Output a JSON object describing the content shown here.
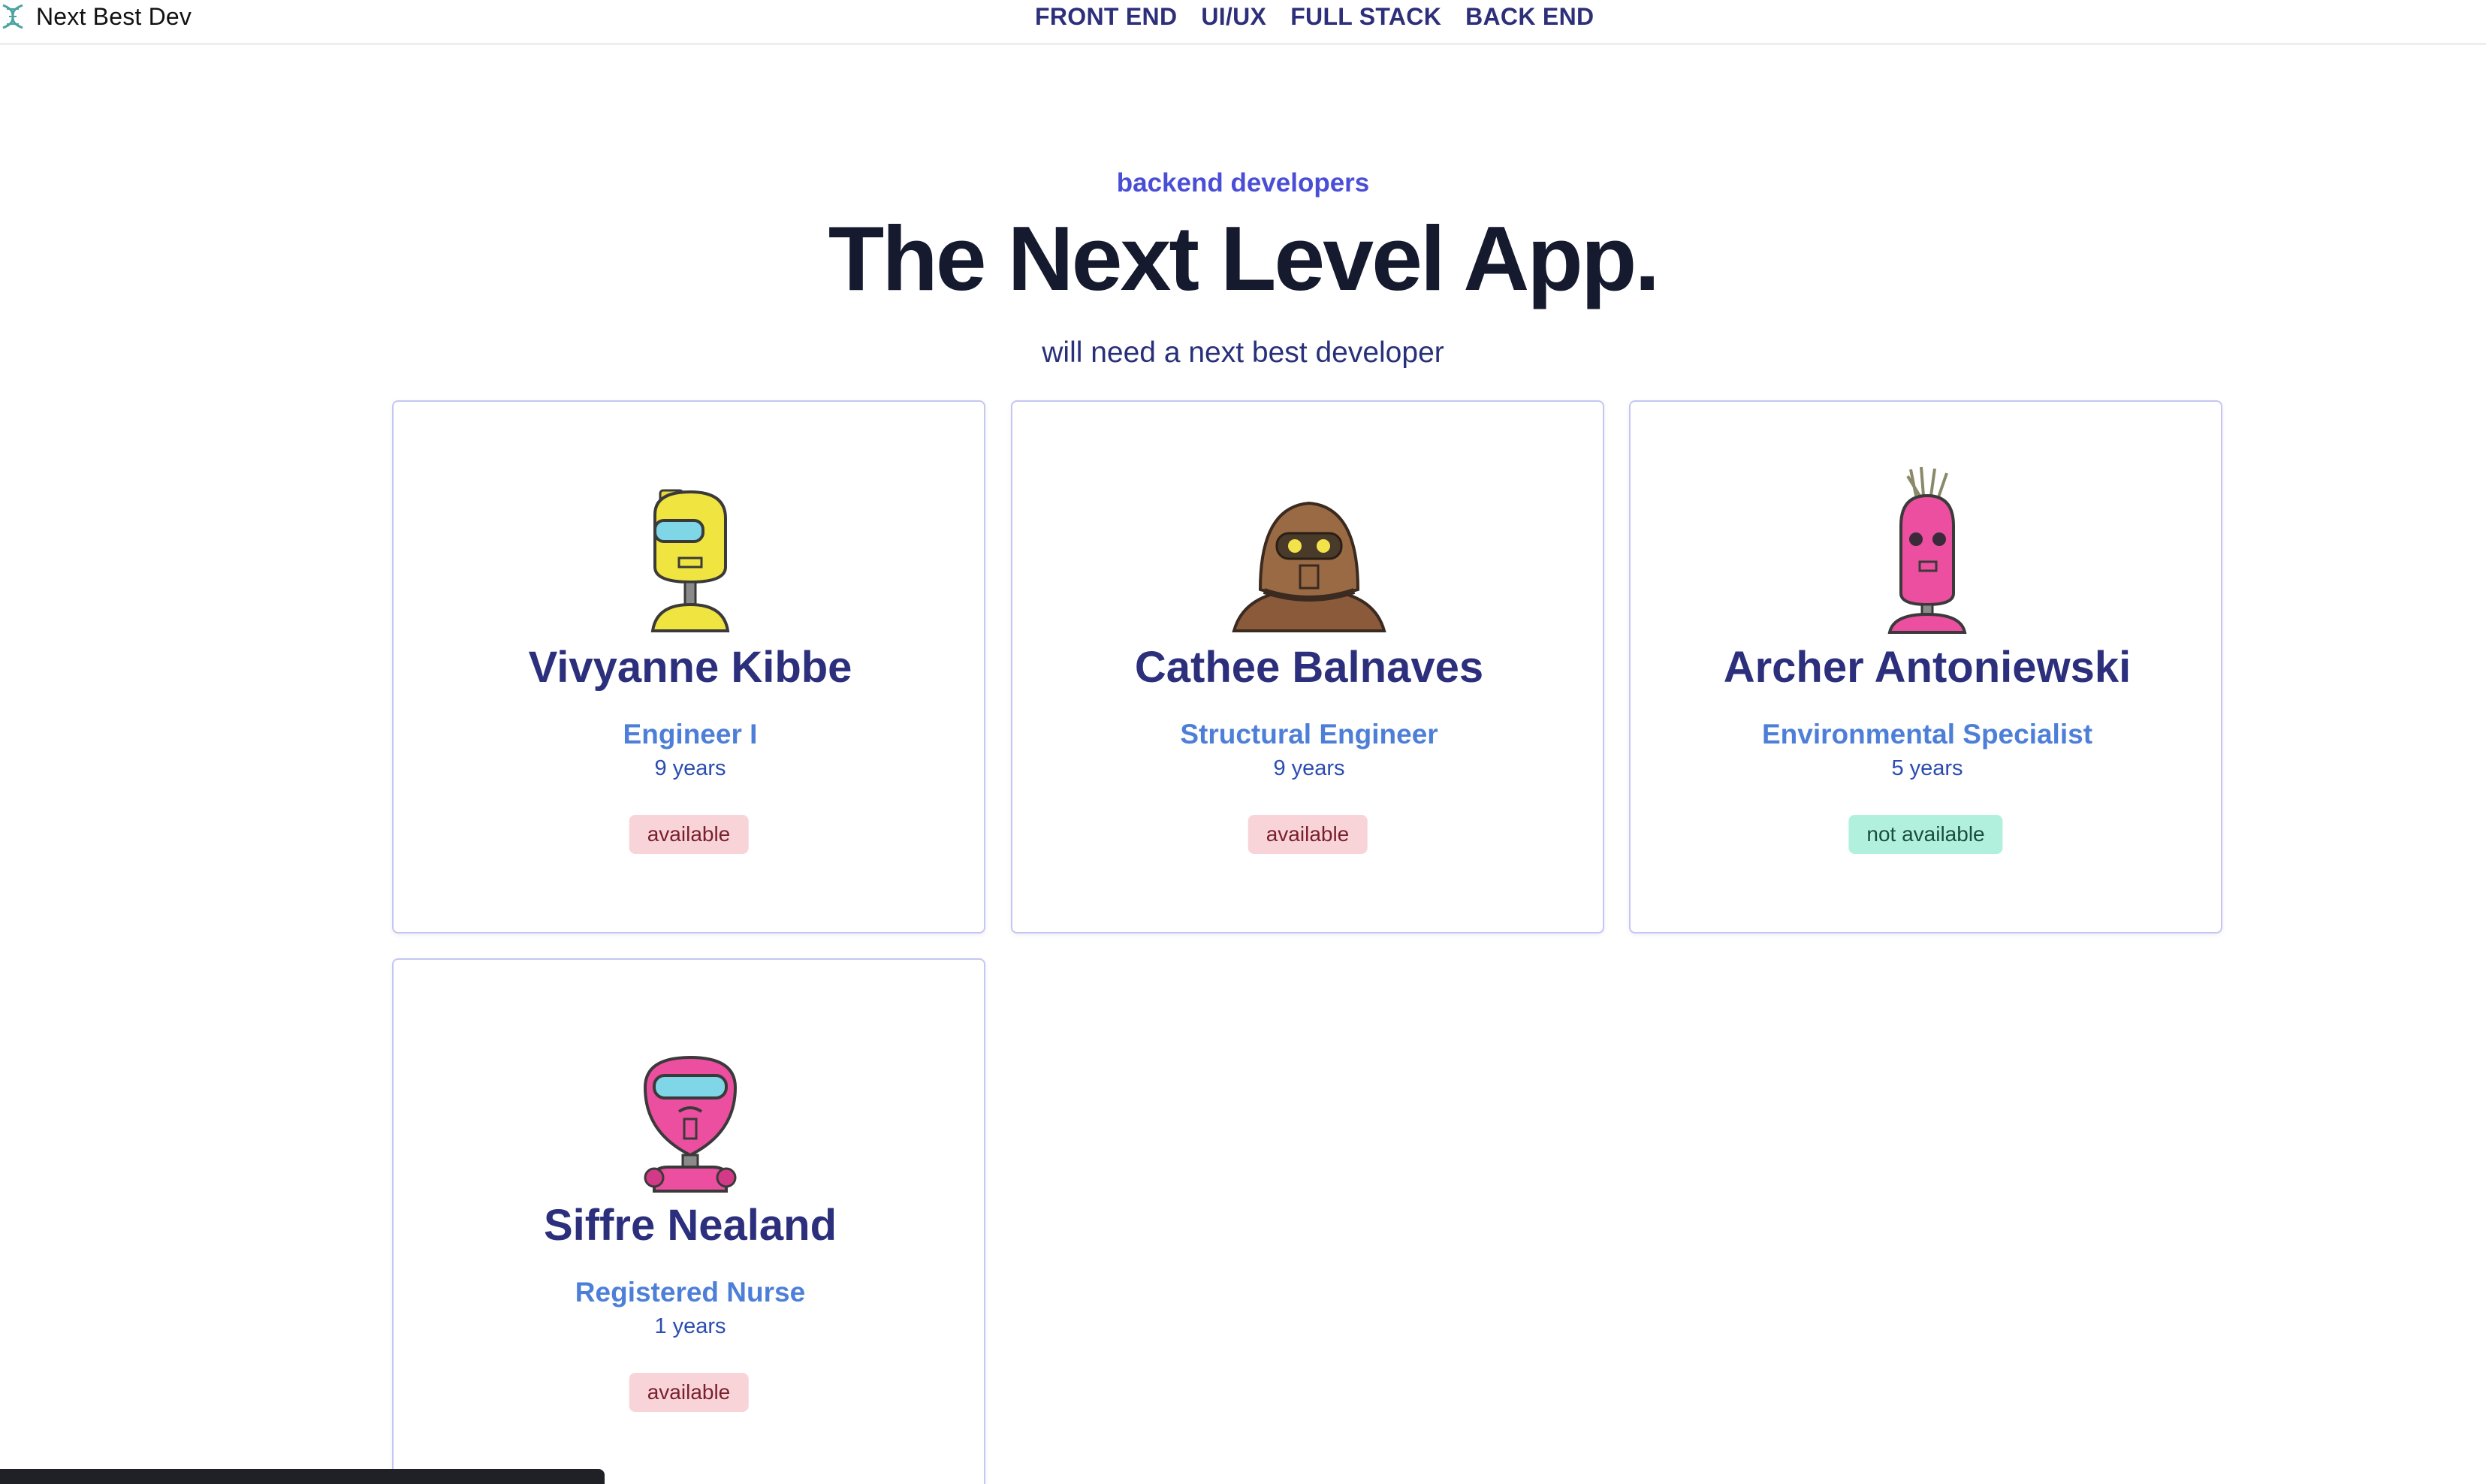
{
  "brand": {
    "name": "Next Best Dev",
    "icon": "dna-helix-icon",
    "color": "#4aa3a0"
  },
  "nav": [
    {
      "label": "FRONT END"
    },
    {
      "label": "UI/UX"
    },
    {
      "label": "FULL STACK"
    },
    {
      "label": "BACK END"
    }
  ],
  "hero": {
    "eyebrow": "backend developers",
    "title": "The Next Level App.",
    "subtitle": "will need a next best developer"
  },
  "developers": [
    {
      "name": "Vivyanne Kibbe",
      "role": "Engineer I",
      "experience": "9 years",
      "status": "available",
      "avatar": "yellow-robot-avatar"
    },
    {
      "name": "Cathee Balnaves",
      "role": "Structural Engineer",
      "experience": "9 years",
      "status": "available",
      "avatar": "brown-robot-avatar"
    },
    {
      "name": "Archer Antoniewski",
      "role": "Environmental Specialist",
      "experience": "5 years",
      "status": "not available",
      "avatar": "pink-antenna-robot-avatar"
    },
    {
      "name": "Siffre Nealand",
      "role": "Registered Nurse",
      "experience": "1 years",
      "status": "available",
      "avatar": "pink-robot-avatar"
    }
  ],
  "colors": {
    "accent": "#4a4ed6",
    "heading": "#151a2e",
    "name": "#2c2f7c",
    "role": "#4d7fd8",
    "available_bg": "#f8d4d9",
    "not_available_bg": "#b2f0de"
  }
}
